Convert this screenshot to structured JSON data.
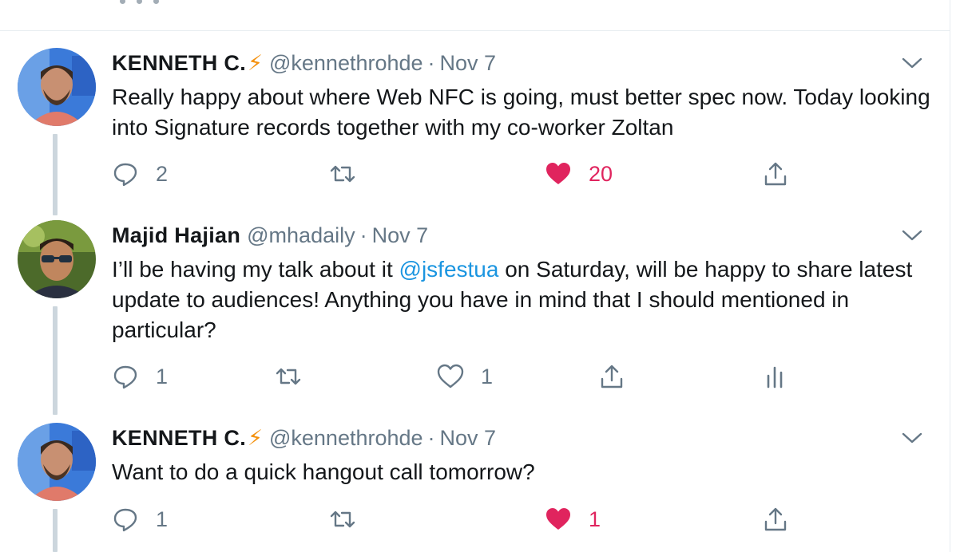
{
  "tweets": [
    {
      "name": "KENNETH C.",
      "badge": "⚡",
      "handle": "@kennethrohde",
      "separator": "·",
      "date": "Nov 7",
      "text": "Really happy about where Web NFC is going, must better spec now. Today looking into Signature records together with my co-worker Zoltan",
      "reply_count": "2",
      "like_count": "20",
      "liked": true
    },
    {
      "name": "Majid Hajian",
      "handle": "@mhadaily",
      "separator": "·",
      "date": "Nov 7",
      "text_before": "I’ll be having my talk about it ",
      "mention": "@jsfestua",
      "text_after": " on Saturday, will be happy to share latest update to audiences! Anything you have in mind that I should mentioned in particular?",
      "reply_count": "1",
      "like_count": "1",
      "liked": false
    },
    {
      "name": "KENNETH C.",
      "badge": "⚡",
      "handle": "@kennethrohde",
      "separator": "·",
      "date": "Nov 7",
      "text": "Want to do a quick hangout call tomorrow?",
      "reply_count": "1",
      "like_count": "1",
      "liked": true
    }
  ],
  "colors": {
    "text_primary": "#14171a",
    "text_secondary": "#657786",
    "like_active": "#e0245e",
    "mention": "#1b95e0",
    "thread_line": "#ccd6dd",
    "bolt": "#f4900c"
  },
  "icons": [
    "reply-icon",
    "retweet-icon",
    "like-icon",
    "share-icon",
    "analytics-icon",
    "chevron-down-icon",
    "lightning-emoji"
  ]
}
